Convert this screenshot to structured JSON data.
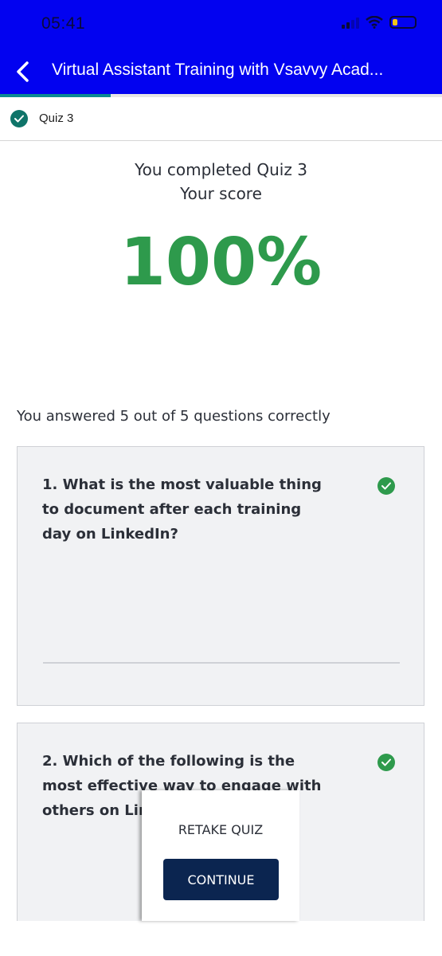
{
  "status_bar": {
    "time": "05:41"
  },
  "header": {
    "title": "Virtual Assistant Training with Vsavvy Acad...",
    "progress_fraction": 0.25
  },
  "quiz_row": {
    "label": "Quiz 3"
  },
  "result": {
    "completed_text": "You completed Quiz 3",
    "score_label": "Your score",
    "score_value": "100%",
    "answered_text": "You answered 5 out of 5 questions correctly"
  },
  "questions": [
    {
      "text": "1. What is the most valuable thing to document after each training day on LinkedIn?"
    },
    {
      "text": "2. Which of the following is the most effective way to engage with others on LinkedIn?"
    }
  ],
  "actions": {
    "retake_label": "RETAKE QUIZ",
    "continue_label": "CONTINUE"
  },
  "colors": {
    "header_bg": "#0202f0",
    "score": "#2e9a4c",
    "continue_bg": "#0b2550",
    "check": "#0f7469"
  }
}
